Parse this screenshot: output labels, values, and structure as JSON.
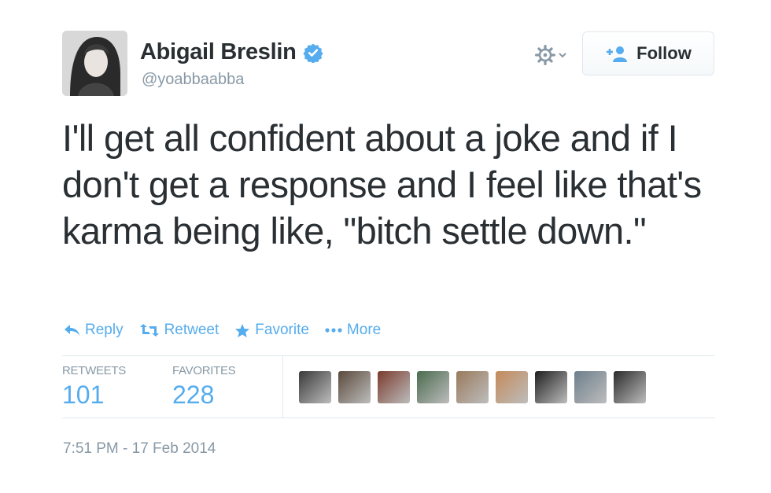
{
  "user": {
    "display_name": "Abigail Breslin",
    "handle": "@yoabbaabba",
    "verified": true
  },
  "header": {
    "follow_label": "Follow"
  },
  "tweet": {
    "text": "I'll get all confident about a joke and if I don't get a response and I feel like that's karma being like, \"bitch settle down.\"",
    "timestamp": "7:51 PM - 17 Feb 2014"
  },
  "actions": [
    {
      "label": "Reply",
      "icon": "reply-icon"
    },
    {
      "label": "Retweet",
      "icon": "retweet-icon"
    },
    {
      "label": "Favorite",
      "icon": "star-icon"
    },
    {
      "label": "More",
      "icon": "more-dots-icon"
    }
  ],
  "stats": {
    "retweets_label": "RETWEETS",
    "retweets_value": "101",
    "favorites_label": "FAVORITES",
    "favorites_value": "228"
  },
  "favoriter_avatars": [
    {
      "color": "#3a3a3a"
    },
    {
      "color": "#5b4a3c"
    },
    {
      "color": "#7a3b2e"
    },
    {
      "color": "#4b6b4f"
    },
    {
      "color": "#9a7a5c"
    },
    {
      "color": "#c48a5a"
    },
    {
      "color": "#1f1f1f"
    },
    {
      "color": "#6d7f8c"
    },
    {
      "color": "#2b2b2b"
    }
  ],
  "colors": {
    "accent": "#55acee",
    "text": "#292f33",
    "muted": "#8899a6",
    "border": "#e1e8ed"
  }
}
